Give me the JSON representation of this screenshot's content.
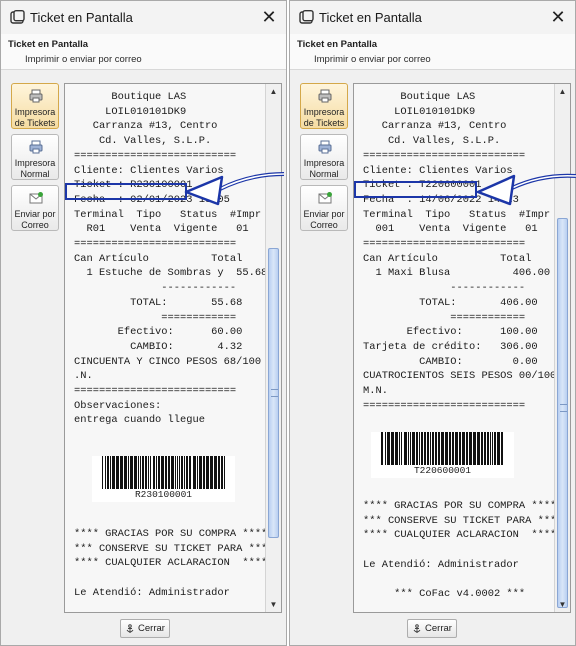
{
  "windows": [
    {
      "title": "Ticket en Pantalla",
      "header_title": "Ticket en Pantalla",
      "header_subtitle": "Imprimir o enviar por correo",
      "buttons": [
        {
          "label": "Impresora\nde Tickets",
          "icon": "receipt-printer-icon",
          "active": true
        },
        {
          "label": "Impresora\nNormal",
          "icon": "printer-icon",
          "active": false
        },
        {
          "label": "Enviar por\nCorreo",
          "icon": "email-icon",
          "active": false
        }
      ],
      "receipt_top": "      Boutique LAS\n     LOIL010101DK9\n   Carranza #13, Centro\n    Cd. Valles, S.L.P.\n==========================\nCliente: Clientes Varios\nTicket : R230100001\nFecha  : 02/01/2023 18:05\nTerminal  Tipo   Status  #Impr\n  R01    Venta  Vigente   01\n==========================\nCan Artículo          Total\n  1 Estuche de Sombras y  55.68\n              ------------\n         TOTAL:       55.68\n              ============\n       Efectivo:      60.00\n         CAMBIO:       4.32\nCINCUENTA Y CINCO PESOS 68/100 M\n.N.\n==========================\nObservaciones:\nentrega cuando llegue",
      "barcode_text": "R230100001",
      "receipt_bottom": "**** GRACIAS POR SU COMPRA *****\n*** CONSERVE SU TICKET PARA ****\n**** CUALQUIER ACLARACION  *****\n\nLe Atendió: Administrador",
      "close_label": "Cerrar"
    },
    {
      "title": "Ticket en Pantalla",
      "header_title": "Ticket en Pantalla",
      "header_subtitle": "Imprimir o enviar por correo",
      "buttons": [
        {
          "label": "Impresora\nde Tickets",
          "icon": "receipt-printer-icon",
          "active": true
        },
        {
          "label": "Impresora\nNormal",
          "icon": "printer-icon",
          "active": false
        },
        {
          "label": "Enviar por\nCorreo",
          "icon": "email-icon",
          "active": false
        }
      ],
      "receipt_top": "      Boutique LAS\n     LOIL010101DK9\n   Carranza #13, Centro\n    Cd. Valles, S.L.P.\n==========================\nCliente: Clientes Varios\nTicket : T220600001\nFecha  : 14/06/2022 14:23\nTerminal  Tipo   Status  #Impr\n  001    Venta  Vigente   01\n==========================\nCan Artículo          Total\n  1 Maxi Blusa          406.00\n              ------------\n         TOTAL:       406.00\n              ============\n       Efectivo:      100.00\nTarjeta de crédito:   306.00\n         CAMBIO:        0.00\nCUATROCIENTOS SEIS PESOS 00/100\nM.N.\n==========================",
      "barcode_text": "T220600001",
      "receipt_bottom": "**** GRACIAS POR SU COMPRA *****\n*** CONSERVE SU TICKET PARA ****\n**** CUALQUIER ACLARACION  *****\n\nLe Atendió: Administrador\n\n     *** CoFac v4.0002 ***",
      "close_label": "Cerrar"
    }
  ],
  "colors": {
    "highlight": "#1c36a8",
    "window_bg": "#f0f0f0",
    "paper_bg": "#f7f7f7"
  }
}
